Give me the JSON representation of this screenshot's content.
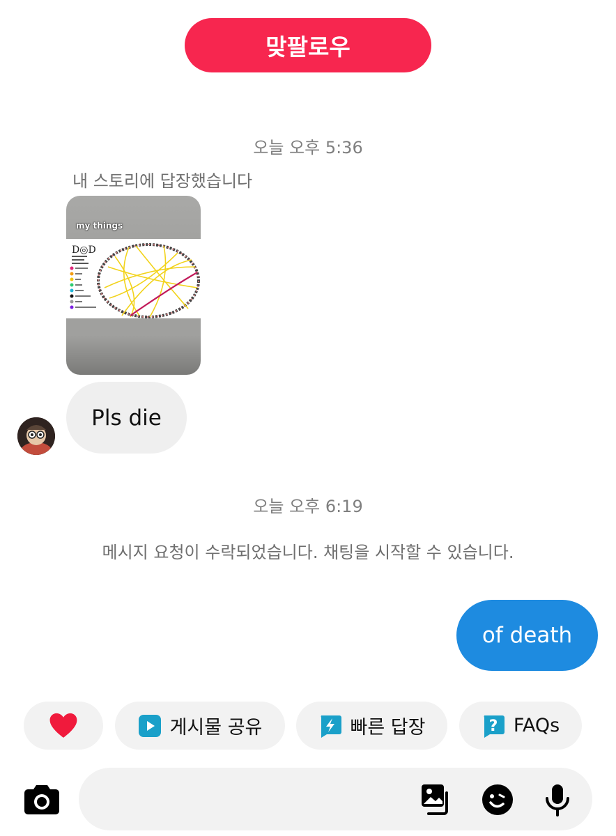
{
  "header": {
    "follow_back_label": "맞팔로우"
  },
  "thread": {
    "timestamp_1": "오늘 오후 5:36",
    "story_reply_caption": "내 스토리에 답장했습니다",
    "story_thumbnail_label": "my things",
    "incoming_message": "Pls die",
    "timestamp_2": "오늘 오후 6:19",
    "request_accepted_note": "메시지 요청이 수락되었습니다. 채팅을 시작할 수 있습니다.",
    "outgoing_message": "of death"
  },
  "quick_actions": {
    "heart_icon": "heart-icon",
    "share_post_label": "게시물 공유",
    "quick_reply_label": "빠른 답장",
    "faqs_label": "FAQs"
  },
  "composer": {
    "placeholder": "",
    "icons": [
      "camera-icon",
      "gallery-icon",
      "sticker-icon",
      "microphone-icon"
    ]
  },
  "colors": {
    "follow_back": "#f7264f",
    "outgoing_bubble": "#1e8be0",
    "incoming_bubble": "#efefef",
    "chip_bg": "#f2f2f2",
    "chip_icon": "#1aa0c9"
  }
}
